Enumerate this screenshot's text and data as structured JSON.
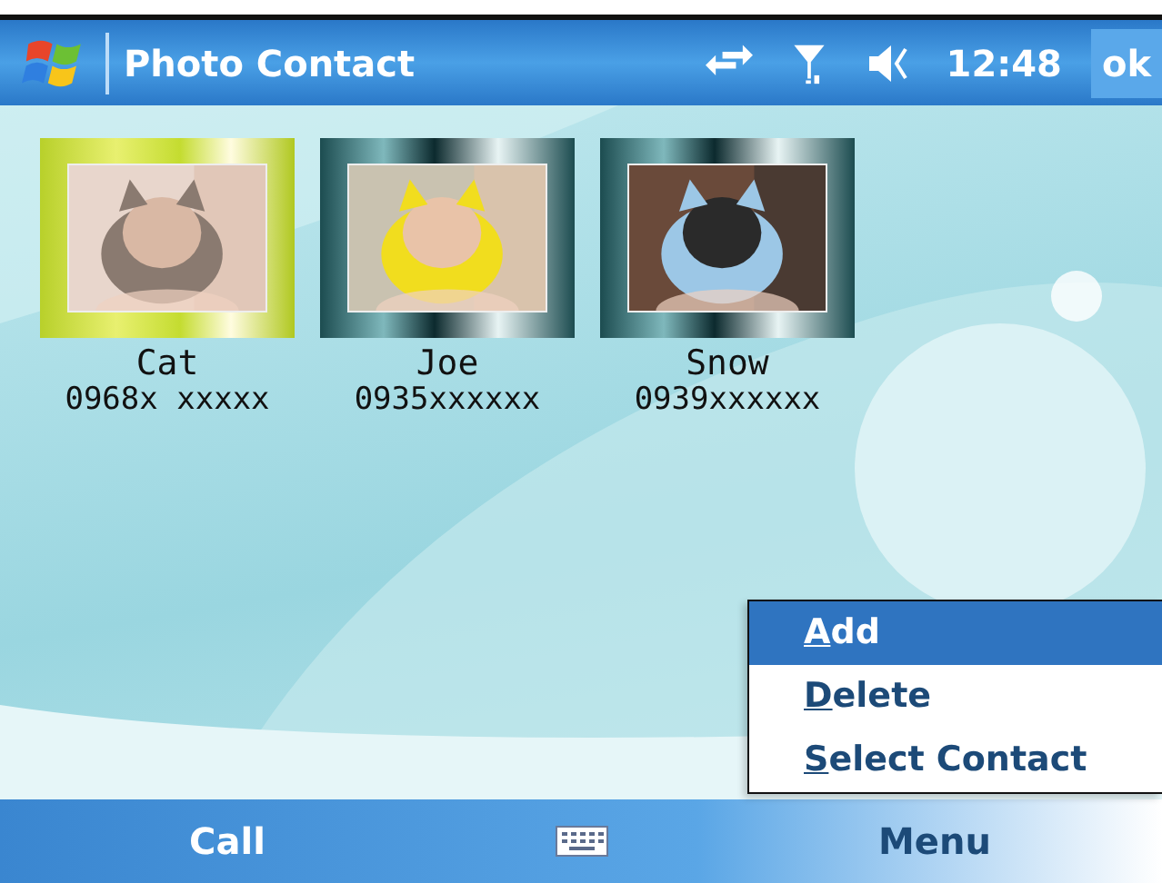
{
  "title_bar": {
    "title": "Photo Contact",
    "time": "12:48",
    "ok": "ok"
  },
  "contacts": [
    {
      "name": "Cat",
      "phone": "0968x xxxxx",
      "selected": true,
      "kind": "picture"
    },
    {
      "name": "Joe",
      "phone": "0935xxxxxx",
      "selected": false,
      "kind": "picture"
    },
    {
      "name": "Snow",
      "phone": "0939xxxxxx",
      "selected": false,
      "kind": "picture"
    }
  ],
  "menu": [
    {
      "label": "Add",
      "selected": true
    },
    {
      "label": "Delete",
      "selected": false
    },
    {
      "label": "Select Contact",
      "selected": false
    }
  ],
  "softkeys": {
    "left": "Call",
    "right": "Menu"
  }
}
